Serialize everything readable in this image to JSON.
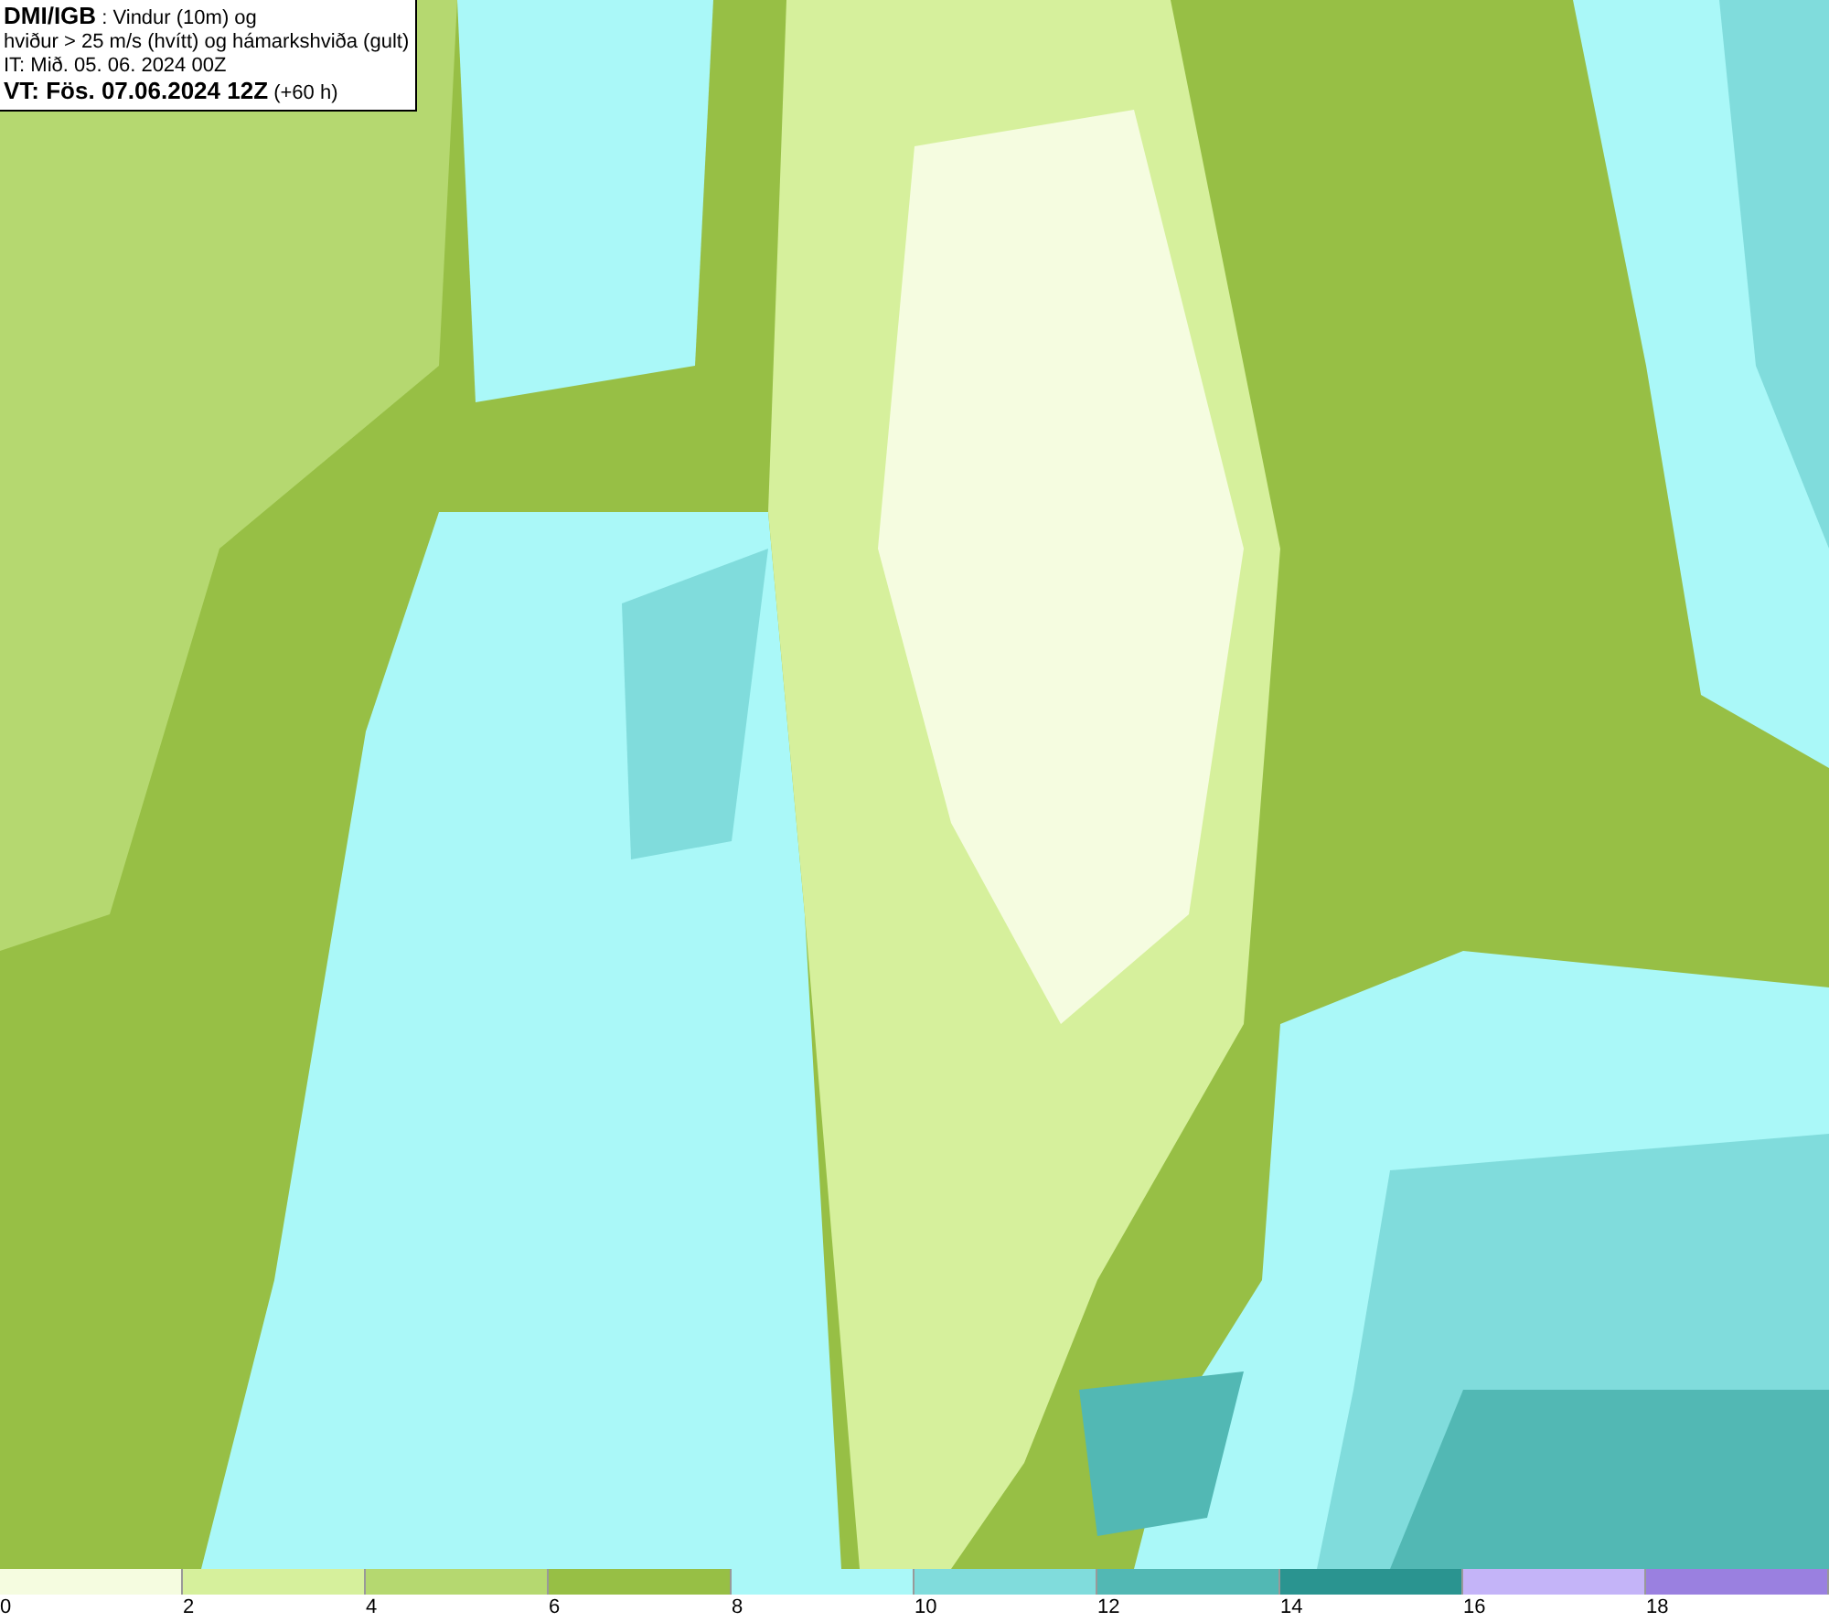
{
  "title_box": {
    "lines": [
      "**DMI/IGB** : Vindur (10m) og",
      "hviður > 25 m/s (hvítt) og hámarkshviða (gult)",
      "IT: Mið. 05. 06. 2024 00Z",
      "**VT: Fös. 07.06.2024 12Z** (+60 h)"
    ]
  },
  "legend": {
    "bins": [
      {
        "color": "#f5fce0"
      },
      {
        "color": "#d6f09c"
      },
      {
        "color": "#b5d870"
      },
      {
        "color": "#97bf45"
      },
      {
        "color": "#aaf8f8"
      },
      {
        "color": "#80dcdc"
      },
      {
        "color": "#52b8b4"
      },
      {
        "color": "#2a9490"
      },
      {
        "color": "#c4b4f8"
      },
      {
        "color": "#9a80e0"
      }
    ],
    "labels": [
      "0",
      "2",
      "4",
      "6",
      "8",
      "10",
      "12",
      "14",
      "16",
      "18"
    ]
  }
}
